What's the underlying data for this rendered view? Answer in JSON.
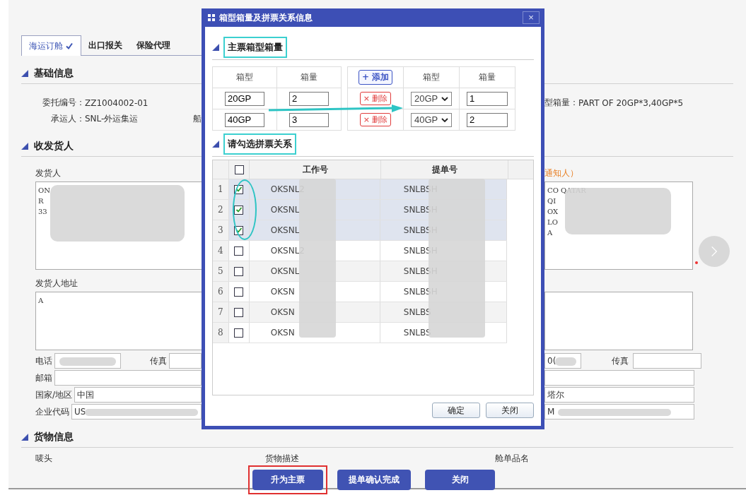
{
  "tabs": [
    {
      "label": "海运订舱",
      "selected": true,
      "done": true
    },
    {
      "label": "出口报关",
      "selected": false,
      "done": false
    },
    {
      "label": "保险代理",
      "selected": false,
      "done": false
    }
  ],
  "basic_info": {
    "title": "基础信息",
    "fields": [
      {
        "label": "委托编号：",
        "value": "ZZ1004002-01"
      },
      {
        "label": "承运人：",
        "value": "SNL-外运集运"
      }
    ],
    "cut_label": "船",
    "container_summary": {
      "label": "型箱量：",
      "value": "PART OF 20GP*3,40GP*5"
    }
  },
  "parties": {
    "title": "收发货人",
    "shipper_label": "发货人",
    "shipper_lines": [
      "ON",
      "R",
      "33"
    ],
    "shipper_redacted": true,
    "notify_label": "通知人）",
    "notify_required": true,
    "notify_lines": [
      "CO QATAR",
      "QI",
      "OX",
      "LO",
      "A"
    ],
    "notify_redacted": true,
    "shipper_address_label": "发货人地址",
    "shipper_address": "A",
    "left_contacts": {
      "phone": {
        "label": "电话",
        "redacted": true
      },
      "fax": {
        "label": "传真"
      },
      "email": {
        "label": "邮箱"
      },
      "country": {
        "label": "国家/地区",
        "value": "中国"
      },
      "code": {
        "label": "企业代码",
        "value": "US",
        "redacted": true
      }
    },
    "right_contacts": {
      "phone": {
        "value": "0(",
        "redacted": true
      },
      "fax": {
        "label": "传真"
      },
      "country": {
        "value": "塔尔"
      },
      "code": {
        "value": "M",
        "redacted": true
      }
    }
  },
  "cargo": {
    "title": "货物信息",
    "labels": [
      "唛头",
      "货物描述",
      "舱单品名"
    ]
  },
  "actions": [
    {
      "label": "升为主票",
      "highlighted": true
    },
    {
      "label": "提单确认完成",
      "highlighted": false
    },
    {
      "label": "关闭",
      "highlighted": false
    }
  ],
  "dialog": {
    "title": "箱型箱量及拼票关系信息",
    "close": "×",
    "master_section": {
      "title": "主票箱型箱量",
      "highlighted": true
    },
    "master_table": {
      "columns": [
        "箱型",
        "箱量"
      ],
      "rows": [
        {
          "type": "20GP",
          "qty": "2"
        },
        {
          "type": "40GP",
          "qty": "3"
        }
      ]
    },
    "split_table": {
      "add_button": "+ 添加",
      "columns": [
        "箱型",
        "箱量"
      ],
      "rows": [
        {
          "delete_button": "× 删除",
          "type": "20GP",
          "qty": "1"
        },
        {
          "delete_button": "× 删除",
          "type": "40GP",
          "qty": "2"
        }
      ]
    },
    "arrow": true,
    "grid_section": {
      "title": "请勾选拼票关系",
      "highlighted": true
    },
    "grid": {
      "select_all": false,
      "checks_circled": true,
      "columns": [
        "工作号",
        "提单号"
      ],
      "rows": [
        {
          "num": "1",
          "checked": true,
          "job": "OKSNL2",
          "bill": "SNLBSH"
        },
        {
          "num": "2",
          "checked": true,
          "job": "OKSNL",
          "bill": "SNLBSH"
        },
        {
          "num": "3",
          "checked": true,
          "job": "OKSNL",
          "bill": "SNLBSH"
        },
        {
          "num": "4",
          "checked": false,
          "job": "OKSNL2",
          "bill": "SNLBSH"
        },
        {
          "num": "5",
          "checked": false,
          "job": "OKSNL",
          "bill": "SNLBSH"
        },
        {
          "num": "6",
          "checked": false,
          "job": "OKSN",
          "bill": "SNLBSH"
        },
        {
          "num": "7",
          "checked": false,
          "job": "OKSN",
          "bill": "SNLBS"
        },
        {
          "num": "8",
          "checked": false,
          "job": "OKSN",
          "bill": "SNLBS"
        }
      ]
    },
    "buttons": [
      "确定",
      "关闭"
    ]
  }
}
